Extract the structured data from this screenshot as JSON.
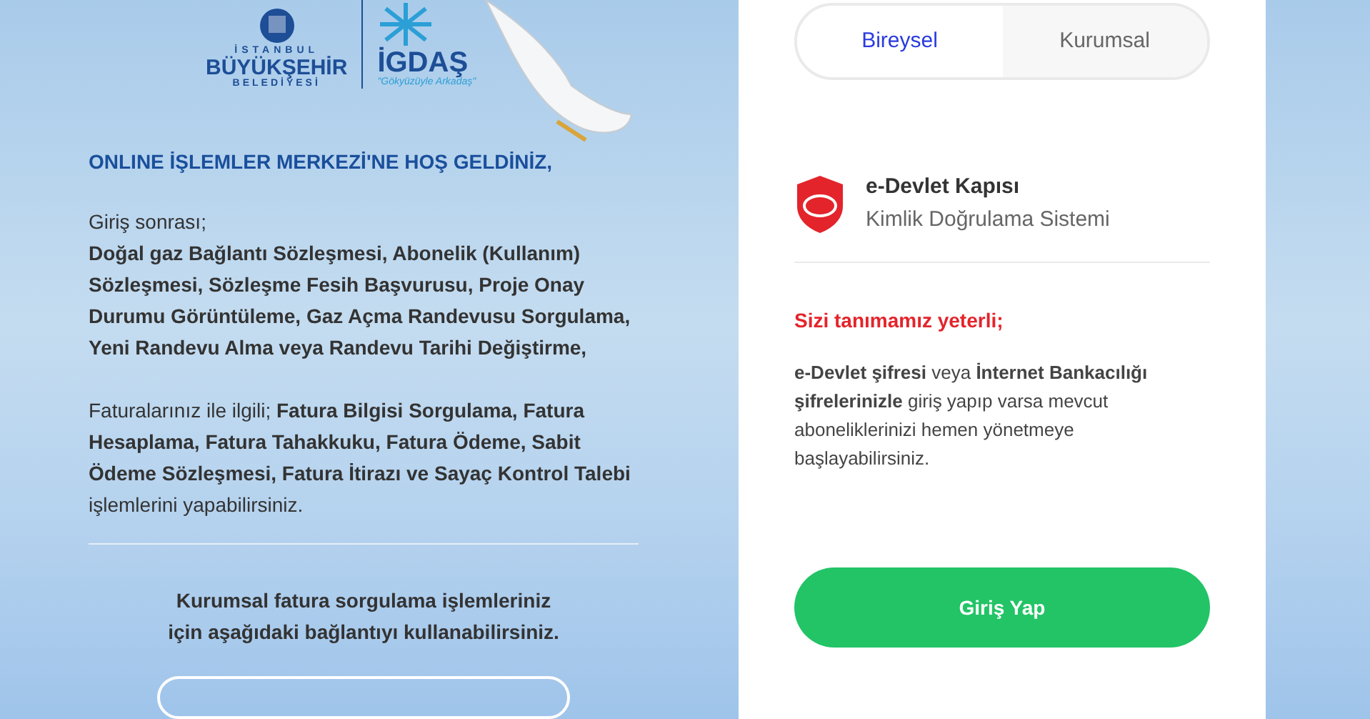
{
  "logos": {
    "ibb": {
      "top": "İSTANBUL",
      "main": "BÜYÜKŞEHİR",
      "bottom": "BELEDİYESİ"
    },
    "igdas": {
      "main": "İGDAŞ",
      "slogan": "\"Gökyüzüyle Arkadaş\""
    }
  },
  "welcome": {
    "title": "ONLINE İŞLEMLER MERKEZİ'NE HOŞ GELDİNİZ,",
    "paragraphs": [
      "Giriş sonrası;\n**Doğal gaz Bağlantı Sözleşmesi, Abonelik (Kullanım) Sözleşmesi, Sözleşme Fesih Başvurusu, Proje Onay Durumu Görüntüleme, Gaz Açma Randevusu Sorgulama, Yeni Randevu Alma veya Randevu Tarihi Değiştirme,**",
      "Faturalarınız ile ilgili; **Fatura Bilgisi Sorgulama, Fatura Hesaplama, Fatura Tahakkuku, Fatura Ödeme, Sabit Ödeme Sözleşmesi, Fatura İtirazı ve Sayaç Kontrol Talebi** işlemlerini yapabilirsiniz."
    ],
    "corporate_note": "Kurumsal fatura sorgulama işlemleriniz için aşağıdaki bağlantıyı kullanabilirsiniz."
  },
  "tabs": [
    {
      "label": "Bireysel",
      "selected": true
    },
    {
      "label": "Kurumsal",
      "selected": false
    }
  ],
  "provider": {
    "title": "e-Devlet Kapısı",
    "subtitle": "Kimlik Doğrulama Sistemi"
  },
  "notice": {
    "heading": "Sizi tanımamız yeterli;",
    "text": "**e-Devlet şifresi** veya **İnternet Bankacılığı şifrelerinizle** giriş yapıp varsa mevcut aboneliklerinizi hemen yönetmeye başlayabilirsiniz."
  },
  "login_button": "Giriş Yap"
}
